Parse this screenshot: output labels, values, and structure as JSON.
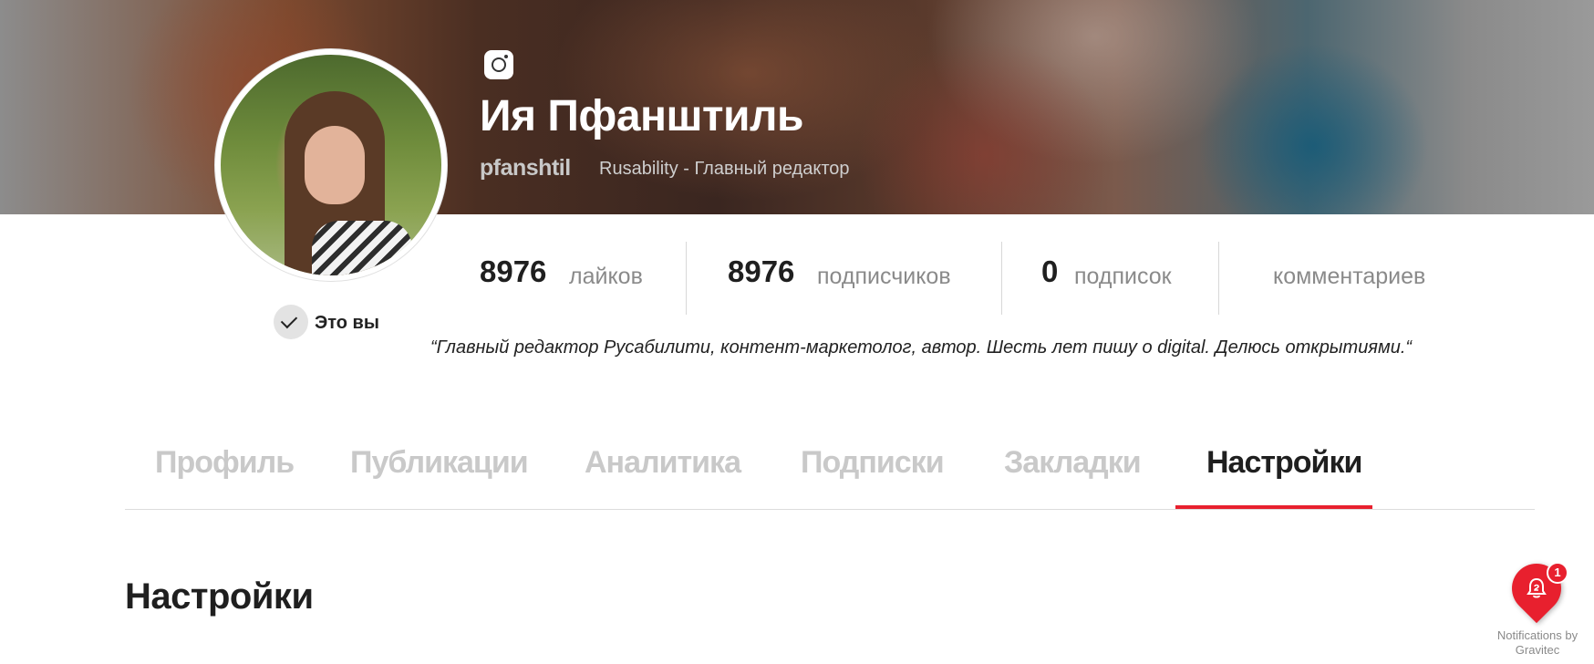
{
  "profile": {
    "name": "Ия Пфанштиль",
    "username": "pfanshtil",
    "company": "Rusability - Главный редактор",
    "social_icon": "instagram-icon",
    "itsyou_label": "Это вы",
    "bio": "“Главный редактор Русабилити, контент-маркетолог, автор. Шесть лет пишу о digital. Делюсь открытиями.“"
  },
  "stats": [
    {
      "value": "8976",
      "label": "лайков"
    },
    {
      "value": "8976",
      "label": "подписчиков"
    },
    {
      "value": "0",
      "label": "подписок"
    },
    {
      "value": "",
      "label": "комментариев"
    }
  ],
  "tabs": [
    {
      "label": "Профиль",
      "active": false
    },
    {
      "label": "Публикации",
      "active": false
    },
    {
      "label": "Аналитика",
      "active": false
    },
    {
      "label": "Подписки",
      "active": false
    },
    {
      "label": "Закладки",
      "active": false
    },
    {
      "label": "Настройки",
      "active": true
    }
  ],
  "section": {
    "title": "Настройки"
  },
  "notifications": {
    "badge": "1",
    "caption_line1": "Notifications by",
    "caption_line2": "Gravitec"
  },
  "colors": {
    "accent": "#e8202e",
    "muted": "#c9c9c9",
    "text": "#1f1f1f"
  }
}
